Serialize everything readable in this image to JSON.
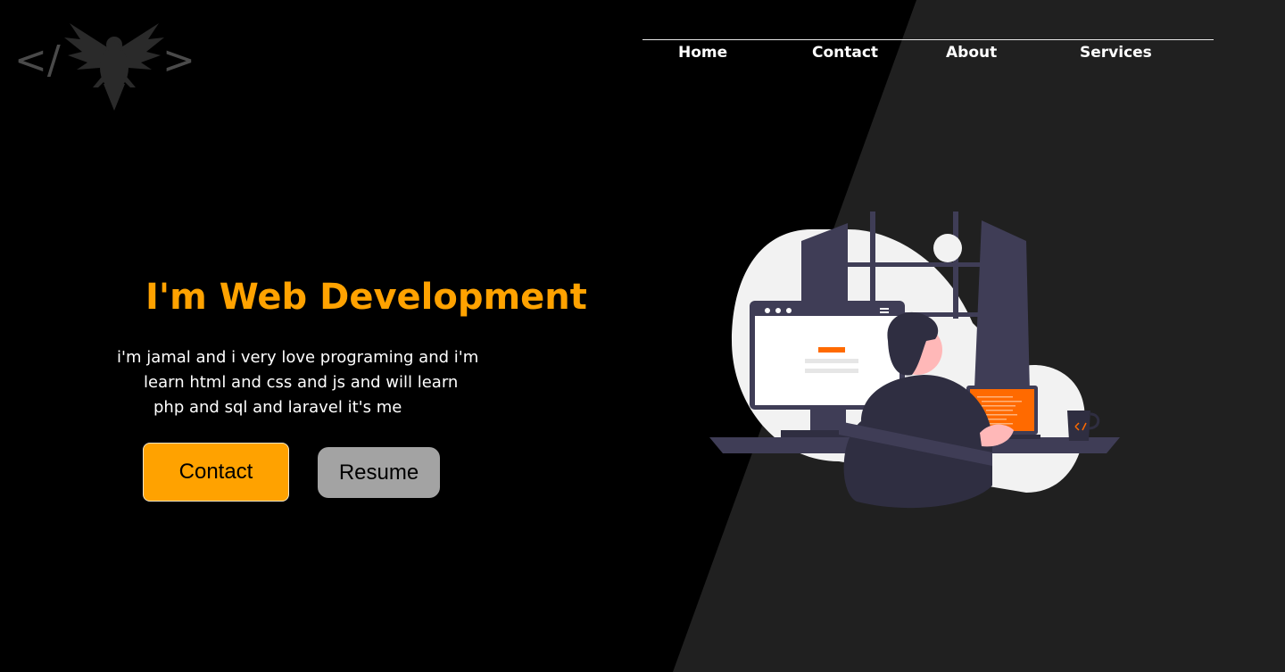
{
  "logo": {
    "left_bracket": "</",
    "right_bracket": ">",
    "icon": "eagle-icon"
  },
  "nav": {
    "items": [
      {
        "label": "Home"
      },
      {
        "label": "Contact"
      },
      {
        "label": "About"
      },
      {
        "label": "Services"
      }
    ]
  },
  "hero": {
    "title": "I'm Web Development",
    "lines": [
      "i'm jamal and i very love programing and i'm",
      "learn html and css and js and will learn",
      "php and sql and laravel it's me"
    ]
  },
  "buttons": {
    "contact": "Contact",
    "resume": "Resume"
  },
  "colors": {
    "background": "#000000",
    "diagonal_panel": "#202020",
    "accent": "#ffa200",
    "resume_button": "#a3a3a3"
  }
}
